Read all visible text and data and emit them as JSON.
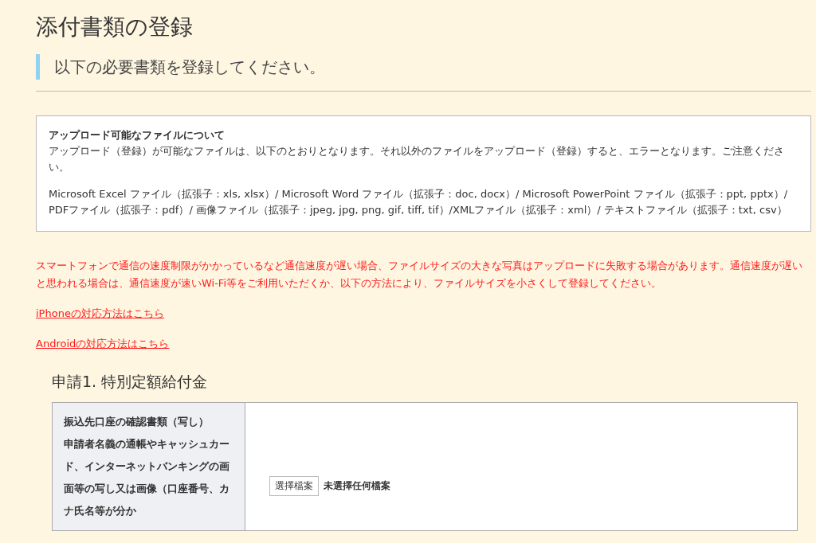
{
  "page_title": "添付書類の登録",
  "subheading": "以下の必要書類を登録してください。",
  "info_box": {
    "title": "アップロード可能なファイルについて",
    "paragraphs": [
      "アップロード（登録）が可能なファイルは、以下のとおりとなります。それ以外のファイルをアップロード（登録）すると、エラーとなります。ご注意ください。",
      "Microsoft Excel ファイル（拡張子：xls, xlsx）/ Microsoft Word ファイル（拡張子：doc, docx）/ Microsoft PowerPoint ファイル（拡張子：ppt, pptx）/ PDFファイル（拡張子：pdf）/ 画像ファイル（拡張子：jpeg, jpg, png, gif, tiff, tif）/XMLファイル（拡張子：xml）/ テキストファイル（拡張子：txt, csv）"
    ]
  },
  "warning": "スマートフォンで通信の速度制限がかかっているなど通信速度が遅い場合、ファイルサイズの大きな写真はアップロードに失敗する場合があります。通信速度が遅いと思われる場合は、通信速度が速いWi-Fi等をご利用いただくか、以下の方法により、ファイルサイズを小さくして登録してください。",
  "links": [
    "iPhoneの対応方法はこちら",
    "Androidの対応方法はこちら"
  ],
  "section": {
    "heading": "申請1. 特別定額給付金",
    "rows": [
      {
        "label_lines": [
          "振込先口座の確認書類（写し）",
          "申請者名義の通帳やキャッシュカード、インターネットバンキングの画面等の写し又は画像（口座番号、カナ氏名等が分か"
        ],
        "file_button": "選擇檔案",
        "file_status": "未選擇任何檔案"
      }
    ]
  }
}
